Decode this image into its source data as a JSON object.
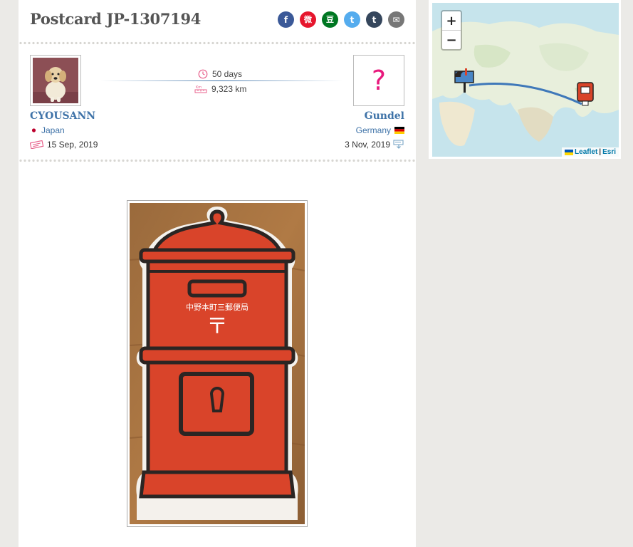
{
  "page": {
    "title": "Postcard JP-1307194"
  },
  "share": [
    {
      "name": "facebook",
      "glyph": "f",
      "color": "#3b5998"
    },
    {
      "name": "weibo",
      "glyph": "微",
      "color": "#e6162d"
    },
    {
      "name": "douban",
      "glyph": "豆",
      "color": "#007722"
    },
    {
      "name": "twitter",
      "glyph": "t",
      "color": "#55acee"
    },
    {
      "name": "tumblr",
      "glyph": "t",
      "color": "#35465c"
    },
    {
      "name": "email",
      "glyph": "✉",
      "color": "#777777"
    }
  ],
  "sender": {
    "username": "CYOUSANN",
    "country": "Japan",
    "sent_date": "15 Sep, 2019"
  },
  "receiver": {
    "username": "Gundel",
    "country": "Germany",
    "received_date": "3 Nov, 2019",
    "avatar_placeholder": "?"
  },
  "travel": {
    "duration": "50 days",
    "distance": "9,323 km",
    "distance_icon_label": "Km"
  },
  "postcard_image": {
    "post_office_text": "中野本町三郵便局",
    "mark": "〒"
  },
  "map": {
    "zoom_in": "+",
    "zoom_out": "−",
    "attribution_leaflet": "Leaflet",
    "attribution_separator": "|",
    "attribution_esri": "Esri"
  }
}
